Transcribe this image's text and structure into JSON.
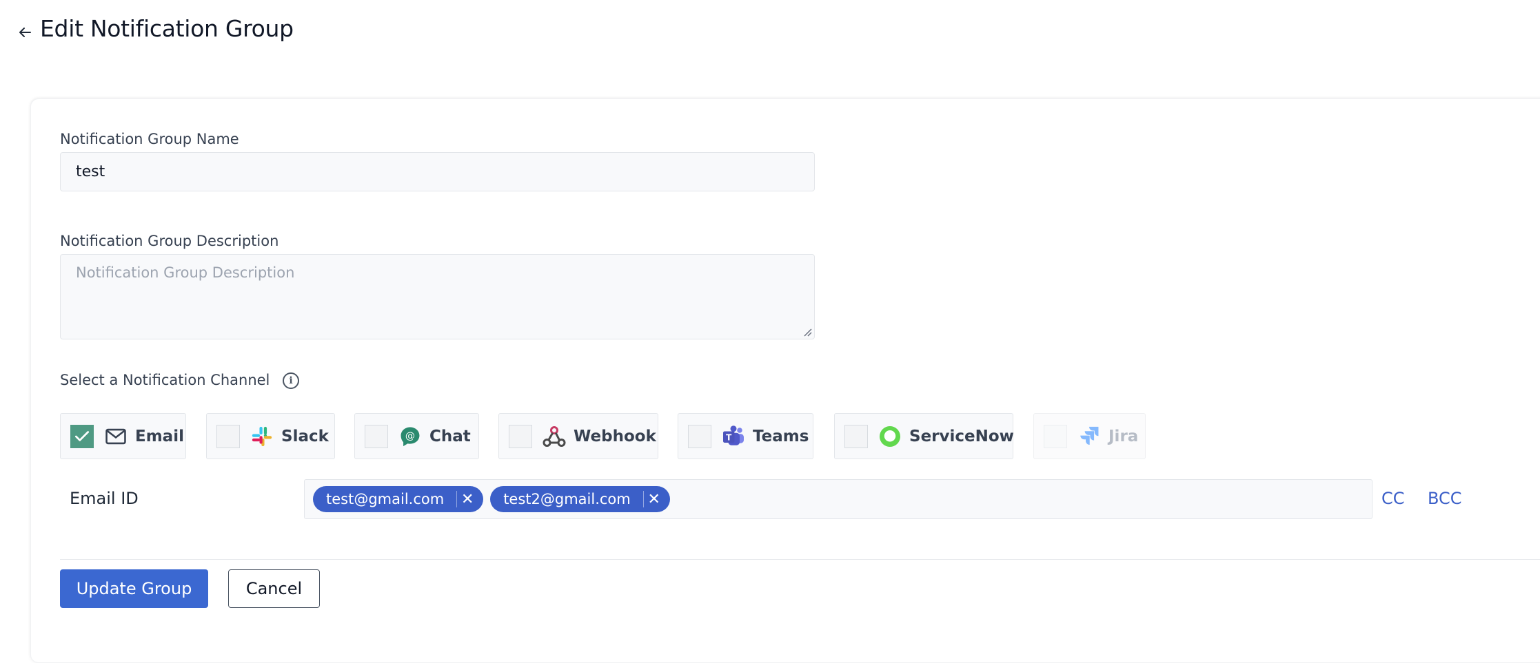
{
  "header": {
    "title": "Edit Notification Group"
  },
  "form": {
    "name_label": "Notification Group Name",
    "name_value": "test",
    "description_label": "Notification Group Description",
    "description_placeholder": "Notification Group Description",
    "channel_label": "Select a Notification Channel",
    "info_glyph": "i"
  },
  "channels": [
    {
      "label": "Email",
      "checked": true,
      "disabled": false,
      "icon": "mail-icon"
    },
    {
      "label": "Slack",
      "checked": false,
      "disabled": false,
      "icon": "slack-icon"
    },
    {
      "label": "Chat",
      "checked": false,
      "disabled": false,
      "icon": "google-chat-icon"
    },
    {
      "label": "Webhook",
      "checked": false,
      "disabled": false,
      "icon": "webhook-icon"
    },
    {
      "label": "Teams",
      "checked": false,
      "disabled": false,
      "icon": "teams-icon"
    },
    {
      "label": "ServiceNow",
      "checked": false,
      "disabled": false,
      "icon": "servicenow-icon"
    },
    {
      "label": "Jira",
      "checked": false,
      "disabled": true,
      "icon": "jira-icon"
    }
  ],
  "email": {
    "label": "Email ID",
    "tags": [
      "test@gmail.com",
      "test2@gmail.com"
    ],
    "remove_glyph": "✕",
    "cc_label": "CC",
    "bcc_label": "BCC"
  },
  "actions": {
    "update_label": "Update Group",
    "cancel_label": "Cancel"
  },
  "colors": {
    "primary": "#3b68d1",
    "tag": "#3b5fc8",
    "checked": "#4f9a83"
  }
}
